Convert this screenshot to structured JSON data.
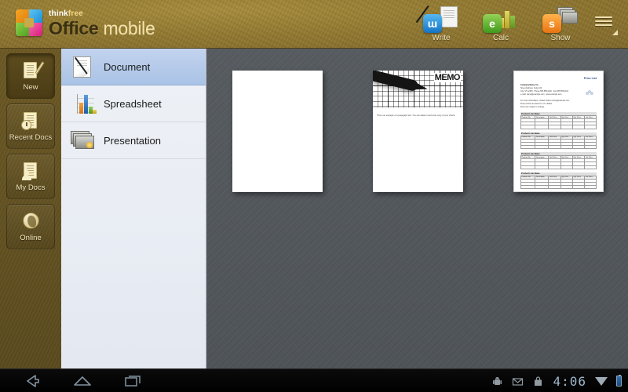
{
  "header": {
    "brand_top": "thinkfree",
    "brand_main": "Office",
    "brand_sub": "mobile",
    "actions": [
      {
        "label": "Write",
        "icon": "write-icon",
        "badge": "w",
        "color": "#1574c4"
      },
      {
        "label": "Calc",
        "icon": "calc-icon",
        "badge": "e",
        "color": "#3f9a1c"
      },
      {
        "label": "Show",
        "icon": "show-icon",
        "badge": "s",
        "color": "#e87412"
      }
    ],
    "menu_icon": "overflow-menu-icon"
  },
  "sidebar": {
    "items": [
      {
        "label": "New",
        "icon": "new-document-icon",
        "selected": true
      },
      {
        "label": "Recent Docs",
        "icon": "recent-docs-icon",
        "selected": false
      },
      {
        "label": "My Docs",
        "icon": "my-docs-icon",
        "selected": false
      },
      {
        "label": "Online",
        "icon": "online-globe-icon",
        "selected": false
      }
    ]
  },
  "panel": {
    "items": [
      {
        "label": "Document",
        "icon": "document-icon",
        "selected": true
      },
      {
        "label": "Spreadsheet",
        "icon": "spreadsheet-icon",
        "selected": false
      },
      {
        "label": "Presentation",
        "icon": "presentation-icon",
        "selected": false
      }
    ]
  },
  "templates": [
    {
      "name": "blank-document-thumbnail",
      "kind": "blank"
    },
    {
      "name": "memo-template-thumbnail",
      "kind": "memo",
      "heading": "MEMO",
      "body": "This is an example of a paragraph text. You can delete it and enter copy of your choice."
    },
    {
      "name": "price-list-template-thumbnail",
      "kind": "pricelist",
      "title": "Price List",
      "company_line": "Company Name, Inc.",
      "address_lines": [
        "Street Address, Suite 100",
        "City, ST 12345  .  Phone 555.555.0100  .  Fax 555.555.0101",
        "e-mail: name@example.com  .  www.example.com"
      ],
      "notes": [
        "For more information, contact: Name name@example.com",
        "Prices shown are listed in U.S. dollars.",
        "Prices are subject to change."
      ],
      "sections": [
        "Product Line Name",
        "Product Line Name",
        "Product Line Name",
        "Product Line Name"
      ],
      "columns": [
        "Product No.",
        "Description",
        "Unit Price",
        "Qty. Disc.",
        "Qty. Price",
        "List Price"
      ],
      "rows_per_section": 3
    }
  ],
  "system_bar": {
    "nav": [
      {
        "label": "Back",
        "icon": "back-arrow-icon"
      },
      {
        "label": "Home",
        "icon": "home-icon"
      },
      {
        "label": "Recents",
        "icon": "recent-apps-icon"
      }
    ],
    "status_icons": [
      {
        "name": "android-robot-icon"
      },
      {
        "name": "gmail-envelope-icon"
      },
      {
        "name": "market-bag-icon"
      }
    ],
    "clock": "4:06",
    "wifi_icon": "wifi-signal-icon",
    "battery_icon": "battery-icon"
  },
  "colors": {
    "header_gold": "#92792f",
    "rail_gold": "#5a4a1e",
    "panel_bg": "#e9edf4",
    "selection_blue": "#aac3e6",
    "canvas_gray": "#525760",
    "clock_blue": "#9fb9cc"
  }
}
